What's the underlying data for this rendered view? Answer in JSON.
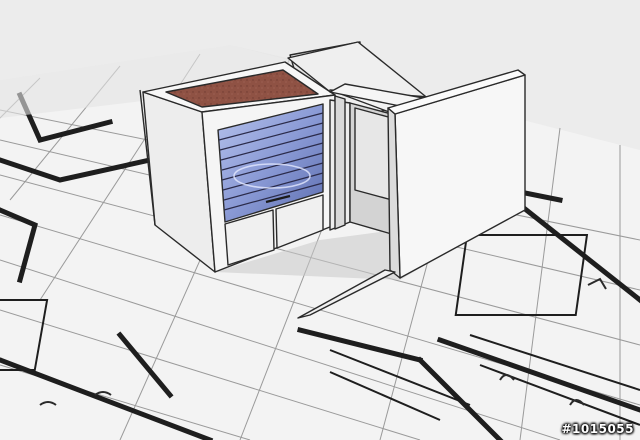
{
  "image": {
    "description_colors": {
      "sky": "#ececec",
      "paper": "#f4f4f4",
      "ink": "#1e1e1e",
      "wall": "#f6f6f6",
      "wall_shadow": "#d8d8d8",
      "roof_fill": "#8a4a3e",
      "glass": "#8fa0d8",
      "glass_dark": "#5a6aa8"
    },
    "watermark": "#1015055"
  }
}
